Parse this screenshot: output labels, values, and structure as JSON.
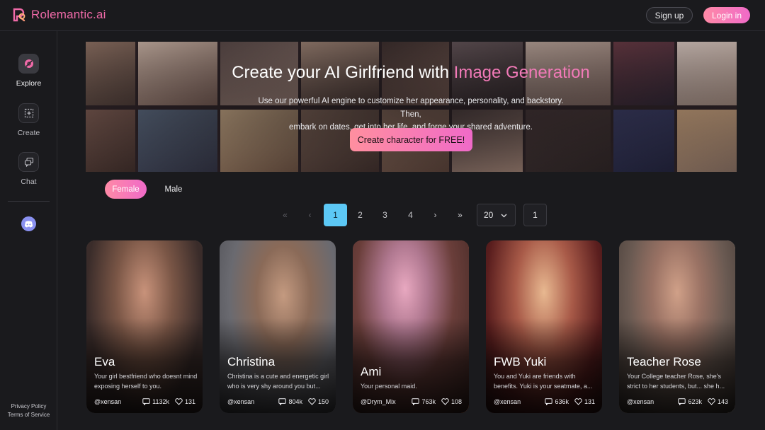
{
  "brand": {
    "name": "Rolemantic.ai",
    "accent": "#f06aa8"
  },
  "header": {
    "signup_label": "Sign up",
    "login_label": "Login in"
  },
  "sidebar": {
    "items": [
      {
        "label": "Explore",
        "icon": "explore-icon",
        "active": true
      },
      {
        "label": "Create",
        "icon": "create-icon",
        "active": false
      },
      {
        "label": "Chat",
        "icon": "chat-icon",
        "active": false
      }
    ],
    "discord_icon": "discord-icon",
    "footer": {
      "privacy": "Privacy Policy",
      "terms": "Terms of Service"
    }
  },
  "hero": {
    "title_plain": "Create your AI Girlfriend with ",
    "title_highlight": "Image Generation",
    "subtitle_line1": "Use our powerful AI engine to customize her appearance, personality, and backstory. Then,",
    "subtitle_line2": "embark on dates, get into her life, and forge your shared adventure.",
    "cta_label": "Create character for FREE!"
  },
  "filters": {
    "female_label": "Female",
    "male_label": "Male",
    "selected": "Female"
  },
  "pagination": {
    "first_symbol": "«",
    "prev_symbol": "‹",
    "pages": [
      "1",
      "2",
      "3",
      "4"
    ],
    "current_page": "1",
    "next_symbol": "›",
    "last_symbol": "»",
    "per_page": "20",
    "goto_value": "1"
  },
  "cards": [
    {
      "name": "Eva",
      "desc_line1": "Your girl bestfriend who doesnt mind",
      "desc_line2": "exposing herself to you.",
      "author": "@xensan",
      "chats": "1132k",
      "likes": "131"
    },
    {
      "name": "Christina",
      "desc_line1": "Christina is a cute and energetic girl",
      "desc_line2": "who is very shy around you but...",
      "author": "@xensan",
      "chats": "804k",
      "likes": "150"
    },
    {
      "name": "Ami",
      "desc_line1": "Your personal maid.",
      "desc_line2": "",
      "author": "@Drym_Mix",
      "chats": "763k",
      "likes": "108"
    },
    {
      "name": "FWB Yuki",
      "desc_line1": "You and Yuki are friends with",
      "desc_line2": "benefits. Yuki is your seatmate, a...",
      "author": "@xensan",
      "chats": "636k",
      "likes": "131"
    },
    {
      "name": "Teacher Rose",
      "desc_line1": "Your College teacher Rose, she's",
      "desc_line2": "strict to her students, but... she h...",
      "author": "@xensan",
      "chats": "623k",
      "likes": "143"
    }
  ]
}
